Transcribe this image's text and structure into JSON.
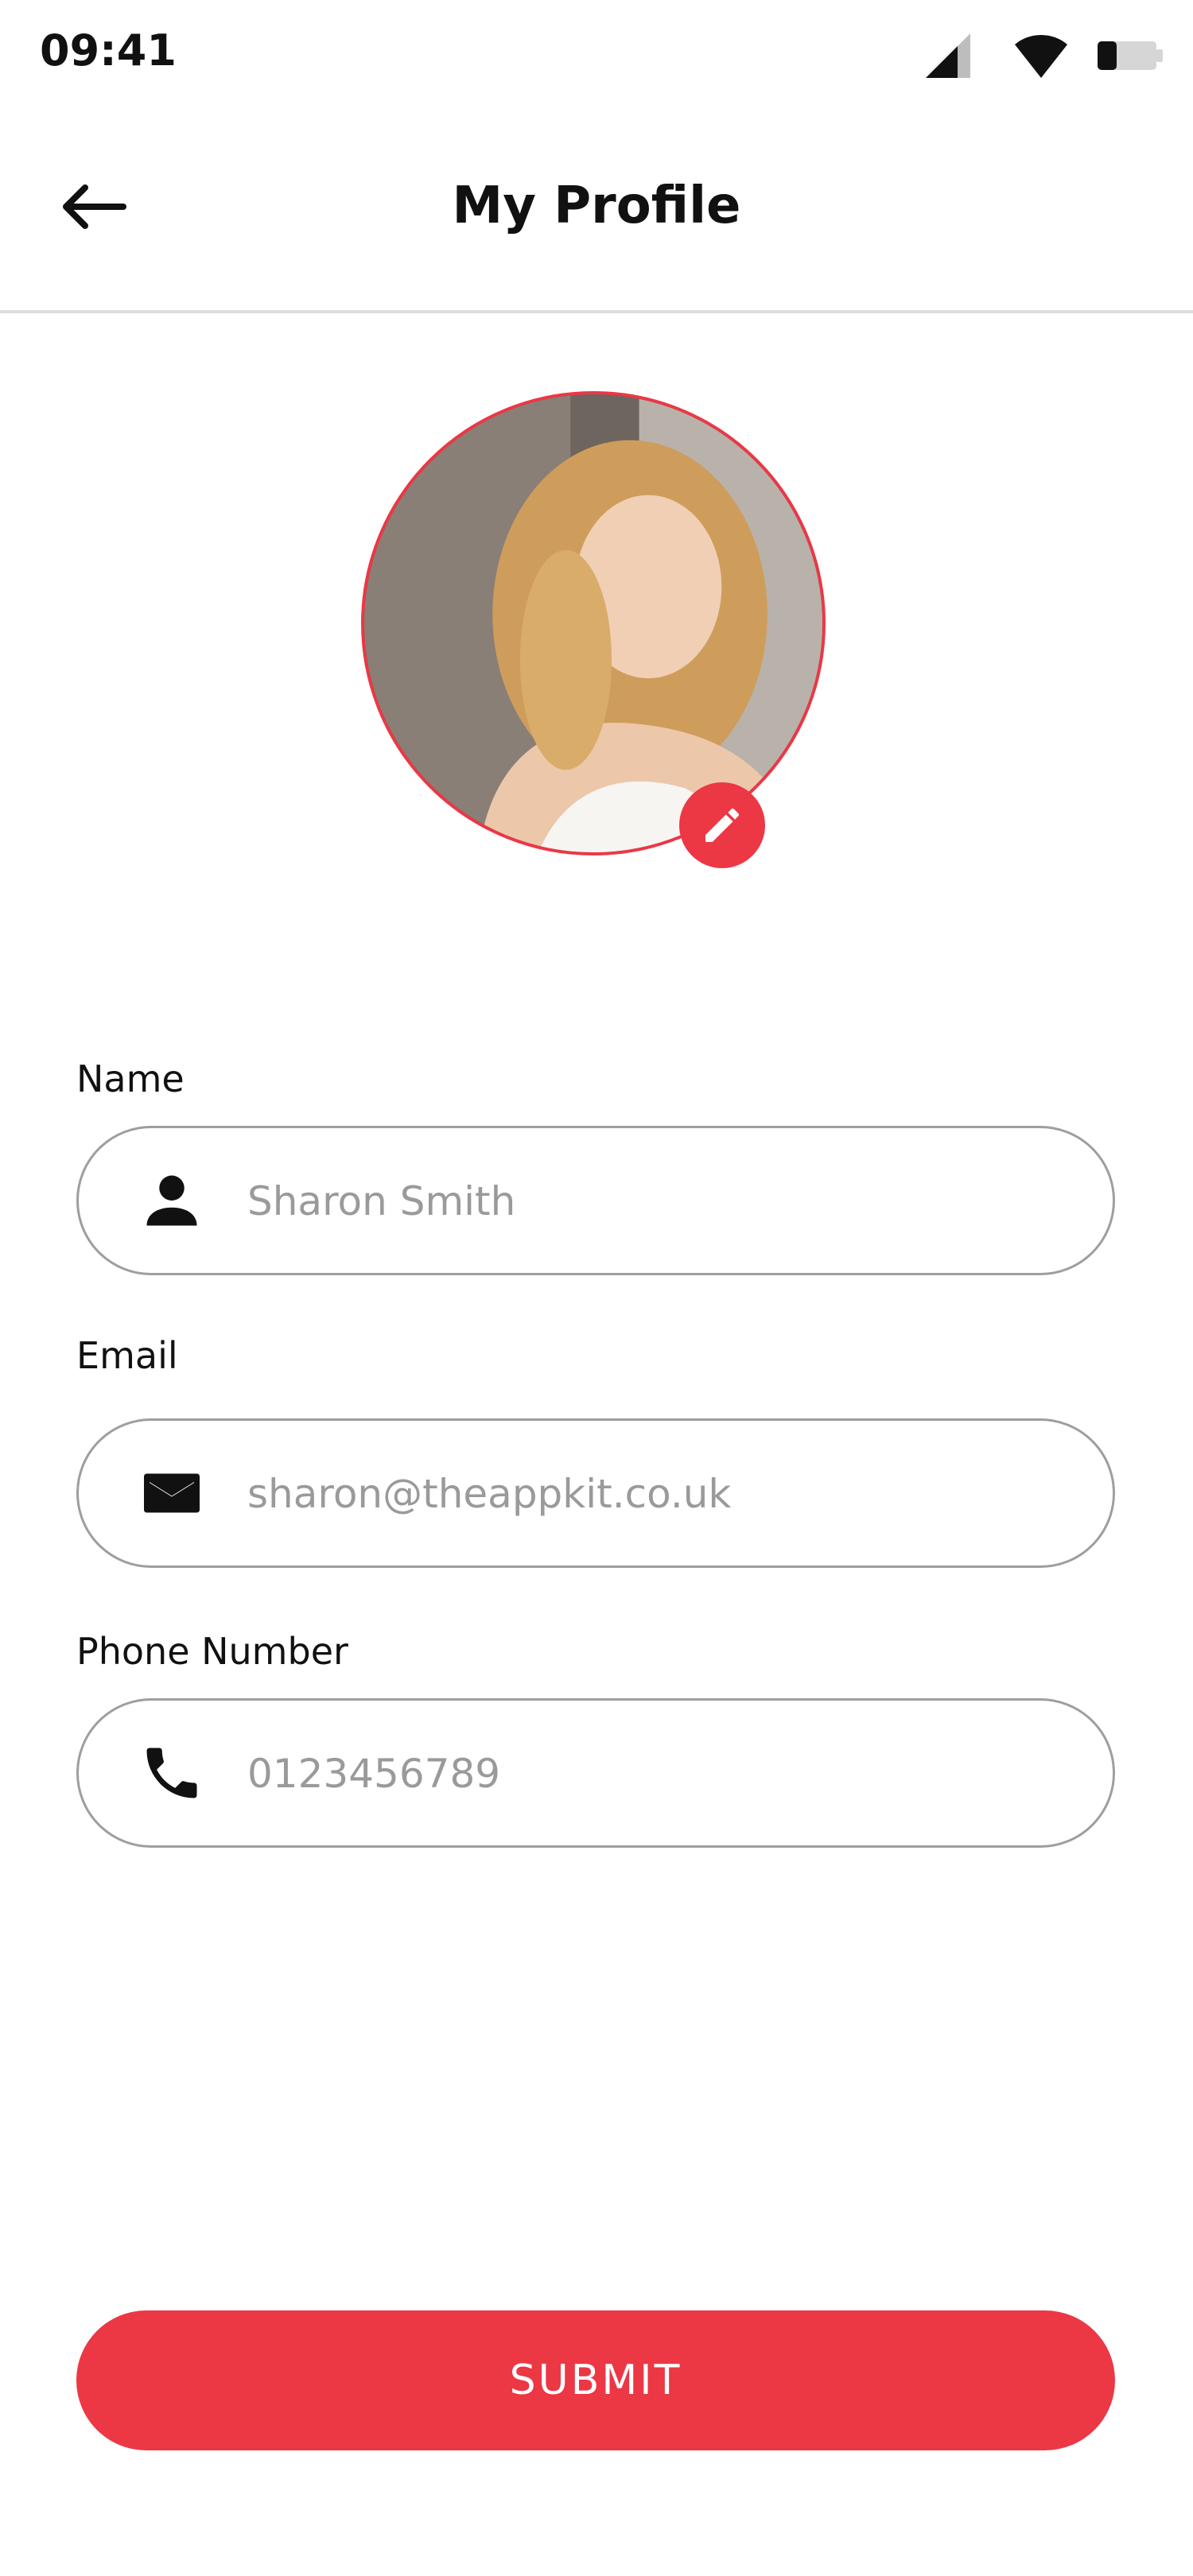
{
  "status_bar": {
    "time": "09:41",
    "icons": [
      "signal-icon",
      "wifi-icon",
      "battery-icon"
    ]
  },
  "header": {
    "title": "My Profile",
    "back_icon": "arrow-left-icon"
  },
  "avatar": {
    "edit_icon": "pencil-icon"
  },
  "form": {
    "name": {
      "label": "Name",
      "value": "Sharon Smith",
      "icon": "person-icon"
    },
    "email": {
      "label": "Email",
      "value": "sharon@theappkit.co.uk",
      "icon": "mail-icon"
    },
    "phone": {
      "label": "Phone Number",
      "value": "0123456789",
      "icon": "phone-icon"
    }
  },
  "submit": {
    "label": "SUBMIT"
  },
  "colors": {
    "accent": "#ec3745",
    "border": "#9e9e9e",
    "placeholder_text": "#9a9a9a",
    "divider": "#dcdcdc"
  }
}
